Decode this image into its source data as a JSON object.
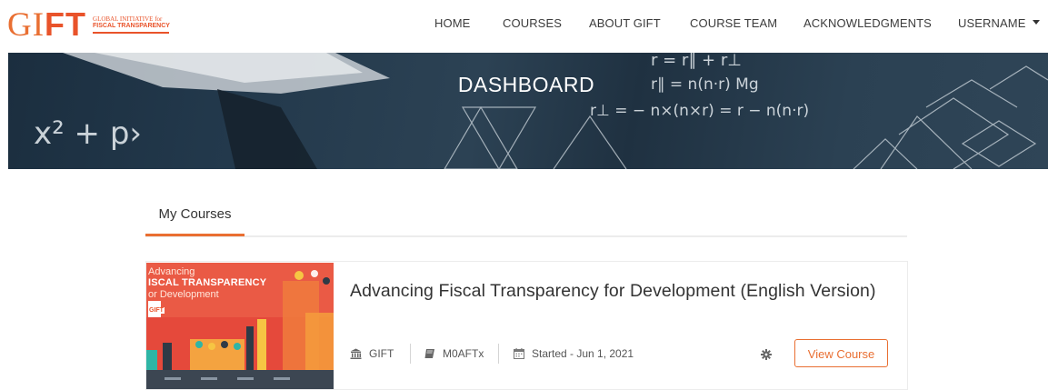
{
  "header": {
    "logo": {
      "mark_left": "GI",
      "mark_right": "FT",
      "line1": "GLOBAL INITIATIVE for",
      "line2": "FISCAL TRANSPARENCY"
    },
    "nav": [
      {
        "label": "HOME"
      },
      {
        "label": "COURSES"
      },
      {
        "label": "ABOUT GIFT"
      },
      {
        "label": "COURSE TEAM"
      },
      {
        "label": "ACKNOWLEDGMENTS"
      },
      {
        "label": "USERNAME"
      }
    ]
  },
  "hero": {
    "title": "DASHBOARD",
    "formula_lines": [
      "r = r∥ + r⊥",
      "r∥ = n(n·r)   Mg",
      "r⊥ = − n×(n×r) = r − n(n·r)",
      "x² + p›"
    ]
  },
  "tabs": [
    {
      "label": "My Courses",
      "active": true
    }
  ],
  "courses": [
    {
      "title": "Advancing Fiscal Transparency for Development (English Version)",
      "thumbnail": {
        "line1": "Advancing",
        "line2": "ISCAL TRANSPARENCY",
        "line3": "or Development",
        "badge": "GIFT"
      },
      "org": "GIFT",
      "code": "M0AFTx",
      "started": "Started - Jun 1, 2021",
      "action_label": "View Course"
    }
  ],
  "colors": {
    "accent": "#e96f32",
    "hero_bg": "#22384b"
  },
  "icons": [
    "institution-icon",
    "book-icon",
    "calendar-icon",
    "gear-icon",
    "caret-down-icon"
  ]
}
